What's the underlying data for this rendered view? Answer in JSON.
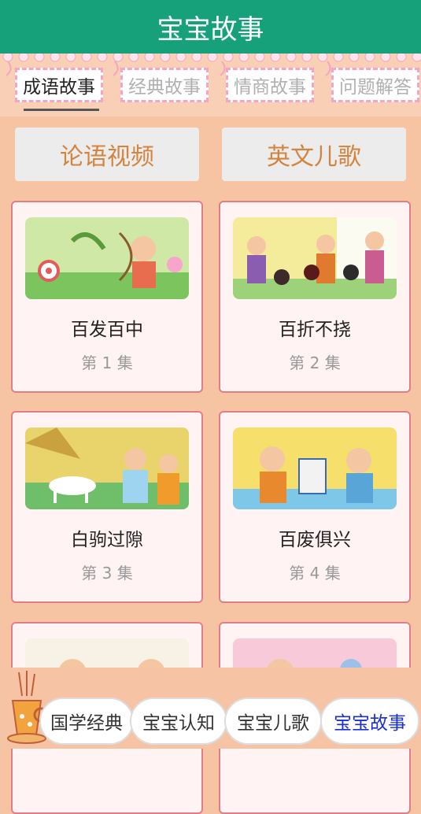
{
  "header": {
    "title": "宝宝故事"
  },
  "tabs": [
    {
      "label": "成语故事",
      "active": true
    },
    {
      "label": "经典故事",
      "active": false
    },
    {
      "label": "情商故事",
      "active": false
    },
    {
      "label": "问题解答",
      "active": false
    }
  ],
  "quick_buttons": {
    "lunyu": "论语视频",
    "english": "英文儿歌"
  },
  "cards": [
    {
      "title": "百发百中",
      "episode": "第 1 集"
    },
    {
      "title": "百折不挠",
      "episode": "第 2 集"
    },
    {
      "title": "白驹过隙",
      "episode": "第 3 集"
    },
    {
      "title": "百废俱兴",
      "episode": "第 4 集"
    }
  ],
  "bottom_nav": [
    {
      "label": "国学经典",
      "active": false
    },
    {
      "label": "宝宝认知",
      "active": false
    },
    {
      "label": "宝宝儿歌",
      "active": false
    },
    {
      "label": "宝宝故事",
      "active": true
    }
  ],
  "colors": {
    "header": "#17a17b",
    "background": "#f7c4a3",
    "quick_button_text": "#d4843e",
    "card_border": "#e07d86",
    "active_nav_text": "#1a2fd6"
  }
}
